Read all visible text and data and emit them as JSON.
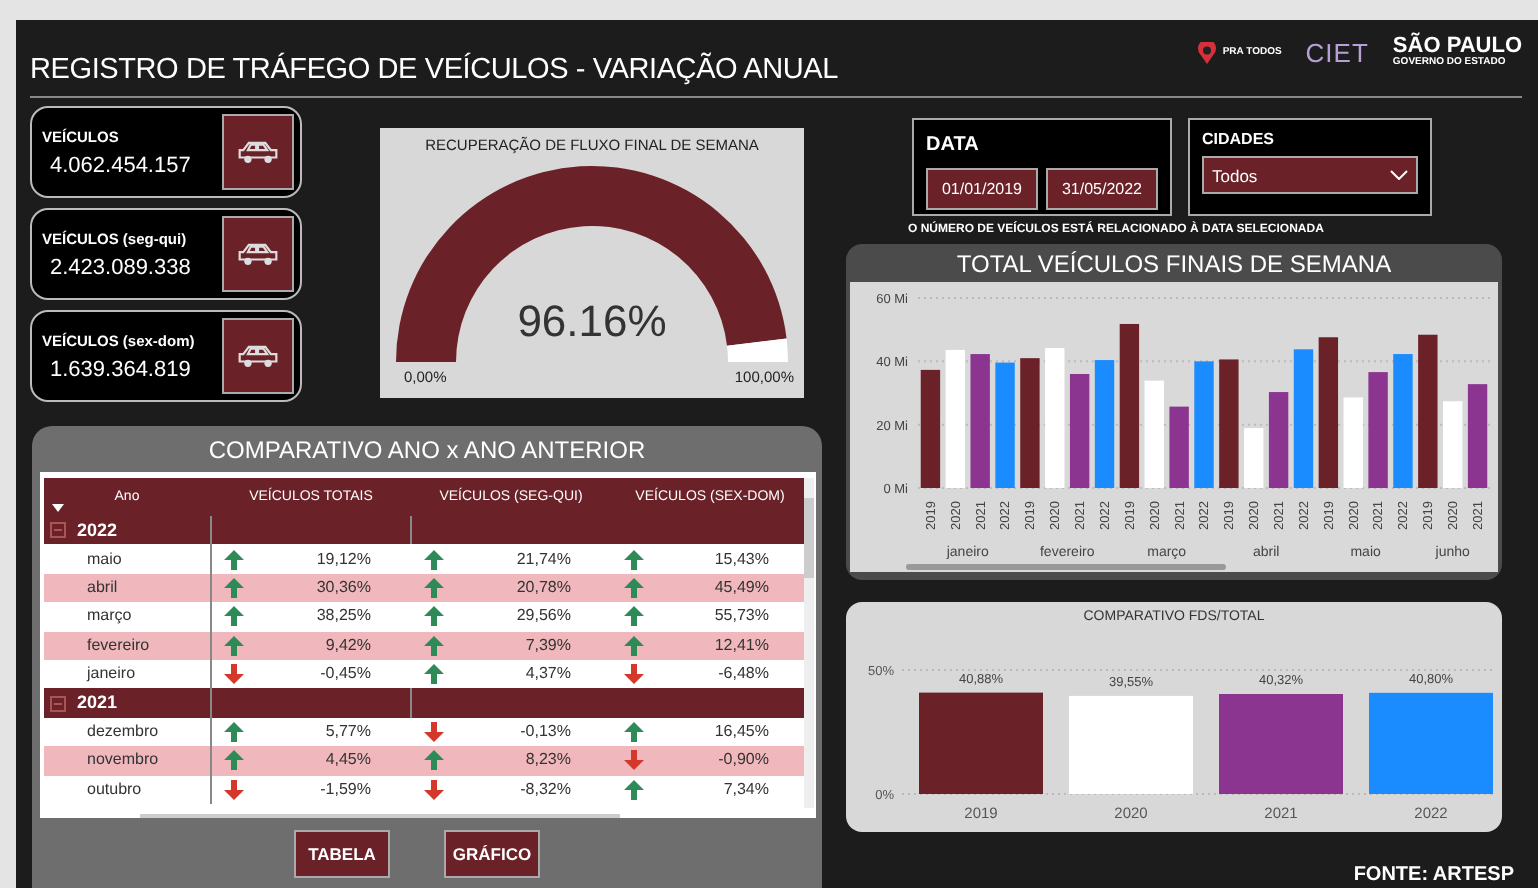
{
  "header": {
    "title": "REGISTRO DE TRÁFEGO DE VEÍCULOS - VARIAÇÃO ANUAL",
    "logos": {
      "pra_todos": "PRA TODOS",
      "ciet": "CIET",
      "sao_paulo": "SÃO PAULO",
      "governo": "GOVERNO DO ESTADO"
    }
  },
  "kpis": [
    {
      "label": "VEÍCULOS",
      "value": "4.062.454.157"
    },
    {
      "label": "VEÍCULOS (seg-qui)",
      "value": "2.423.089.338"
    },
    {
      "label": "VEÍCULOS (sex-dom)",
      "value": "1.639.364.819"
    }
  ],
  "gauge": {
    "title": "RECUPERAÇÃO DE FLUXO FINAL DE SEMANA",
    "reading": "96.16%",
    "min_label": "0,00%",
    "max_label": "100,00%"
  },
  "filters": {
    "date": {
      "label": "DATA",
      "from": "01/01/2019",
      "to": "31/05/2022"
    },
    "cities": {
      "label": "CIDADES",
      "value": "Todos"
    },
    "note": "O NÚMERO DE VEÍCULOS ESTÁ  RELACIONADO À DATA SELECIONADA"
  },
  "table": {
    "title": "COMPARATIVO ANO x ANO ANTERIOR",
    "columns": [
      "Ano",
      "VEÍCULOS TOTAIS",
      "VEÍCULOS (SEG-QUI)",
      "VEÍCULOS (SEX-DOM)"
    ],
    "groups": [
      {
        "year": "2022",
        "expanded": true,
        "rows": [
          {
            "month": "maio",
            "cells": [
              {
                "value": "19,12%",
                "up": true
              },
              {
                "value": "21,74%",
                "up": true
              },
              {
                "value": "15,43%",
                "up": true
              }
            ]
          },
          {
            "month": "abril",
            "cells": [
              {
                "value": "30,36%",
                "up": true
              },
              {
                "value": "20,78%",
                "up": true
              },
              {
                "value": "45,49%",
                "up": true
              }
            ]
          },
          {
            "month": "março",
            "cells": [
              {
                "value": "38,25%",
                "up": true
              },
              {
                "value": "29,56%",
                "up": true
              },
              {
                "value": "55,73%",
                "up": true
              }
            ]
          },
          {
            "month": "fevereiro",
            "cells": [
              {
                "value": "9,42%",
                "up": true
              },
              {
                "value": "7,39%",
                "up": true
              },
              {
                "value": "12,41%",
                "up": true
              }
            ]
          },
          {
            "month": "janeiro",
            "cells": [
              {
                "value": "-0,45%",
                "up": false
              },
              {
                "value": "4,37%",
                "up": true
              },
              {
                "value": "-6,48%",
                "up": false
              }
            ]
          }
        ]
      },
      {
        "year": "2021",
        "expanded": true,
        "rows": [
          {
            "month": "dezembro",
            "cells": [
              {
                "value": "5,77%",
                "up": true
              },
              {
                "value": "-0,13%",
                "up": false
              },
              {
                "value": "16,45%",
                "up": true
              }
            ]
          },
          {
            "month": "novembro",
            "cells": [
              {
                "value": "4,45%",
                "up": true
              },
              {
                "value": "8,23%",
                "up": true
              },
              {
                "value": "-0,90%",
                "up": false
              }
            ]
          },
          {
            "month": "outubro",
            "cells": [
              {
                "value": "-1,59%",
                "up": false
              },
              {
                "value": "-8,32%",
                "up": false
              },
              {
                "value": "7,34%",
                "up": true
              }
            ]
          }
        ]
      }
    ],
    "buttons": [
      {
        "label": "TABELA"
      },
      {
        "label": "GRÁFICO"
      }
    ]
  },
  "weekend_chart": {
    "title": "TOTAL VEÍCULOS FINAIS DE SEMANA",
    "chart_data": {
      "type": "bar",
      "categories": [
        "janeiro",
        "fevereiro",
        "março",
        "abril",
        "maio",
        "junho"
      ],
      "series": [
        {
          "name": "2019",
          "color": "#6b2128",
          "values": [
            37.3,
            41,
            51.8,
            40.6,
            47.6,
            48.4
          ]
        },
        {
          "name": "2020",
          "color": "#ffffff",
          "values": [
            43.6,
            44.2,
            33.9,
            18.9,
            28.6,
            27.4
          ]
        },
        {
          "name": "2021",
          "color": "#8b3591",
          "values": [
            42.3,
            36,
            25.7,
            30.3,
            36.6,
            32.8
          ]
        },
        {
          "name": "2022",
          "color": "#1a8cff",
          "values": [
            39.6,
            40.4,
            40,
            43.8,
            42.3,
            null
          ]
        }
      ],
      "ylim": [
        0,
        60
      ],
      "yticks": [
        {
          "value": 0,
          "label": "0 Mi"
        },
        {
          "value": 20,
          "label": "20 Mi"
        },
        {
          "value": 40,
          "label": "40 Mi"
        },
        {
          "value": 60,
          "label": "60 Mi"
        }
      ]
    }
  },
  "share_chart": {
    "chart_data": {
      "type": "bar",
      "title": "COMPARATIVO FDS/TOTAL",
      "series": [
        {
          "name": "2019",
          "color": "#6b2128",
          "values": [
            40.88
          ]
        },
        {
          "name": "2020",
          "color": "#ffffff",
          "values": [
            39.55
          ]
        },
        {
          "name": "2021",
          "color": "#8b3591",
          "values": [
            40.32
          ]
        },
        {
          "name": "2022",
          "color": "#1a8cff",
          "values": [
            40.8
          ]
        }
      ],
      "ylim": [
        0,
        50
      ],
      "yticks": [
        {
          "value": 0,
          "label": "0%"
        },
        {
          "value": 50,
          "label": "50%"
        }
      ],
      "value_labels": [
        "40,88%",
        "39,55%",
        "40,32%",
        "40,80%"
      ]
    }
  },
  "source": "FONTE: ARTESP"
}
